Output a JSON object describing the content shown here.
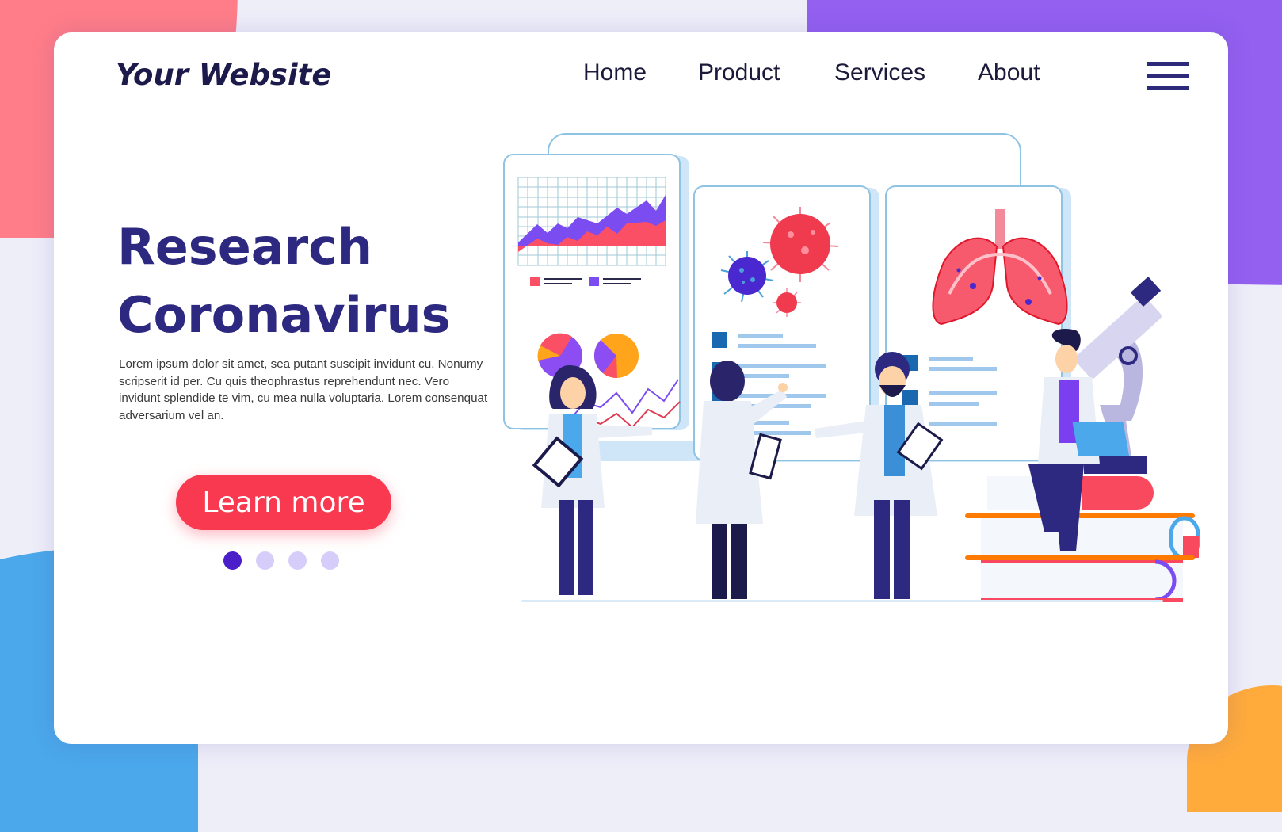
{
  "header": {
    "logo": "Your Website",
    "nav": [
      {
        "label": "Home"
      },
      {
        "label": "Product"
      },
      {
        "label": "Services"
      },
      {
        "label": "About"
      }
    ],
    "menu_icon": "hamburger-menu-icon"
  },
  "hero": {
    "title_line1": "Research",
    "title_line2": "Coronavirus",
    "body": "Lorem ipsum dolor sit amet, sea putant suscipit invidunt cu. Nonumy scripserit id per. Cu quis theophrastus reprehendunt nec. Vero invidunt splendide te vim, cu mea nulla voluptaria. Lorem consenquat adversarium vel an.",
    "cta_label": "Learn more"
  },
  "carousel": {
    "total": 4,
    "active_index": 0
  },
  "colors": {
    "brand_dark": "#2d2880",
    "cta": "#f8394f",
    "dot_active": "#4a1ec8",
    "dot_inactive": "#d7cdfa",
    "blob_red": "#ff7d88",
    "blob_purple": "#9360f0",
    "blob_blue": "#4ba8ea",
    "blob_orange": "#ffab3c"
  },
  "illustration": {
    "subject": "scientists researching coronavirus with charts, virus models, lungs and microscope"
  }
}
